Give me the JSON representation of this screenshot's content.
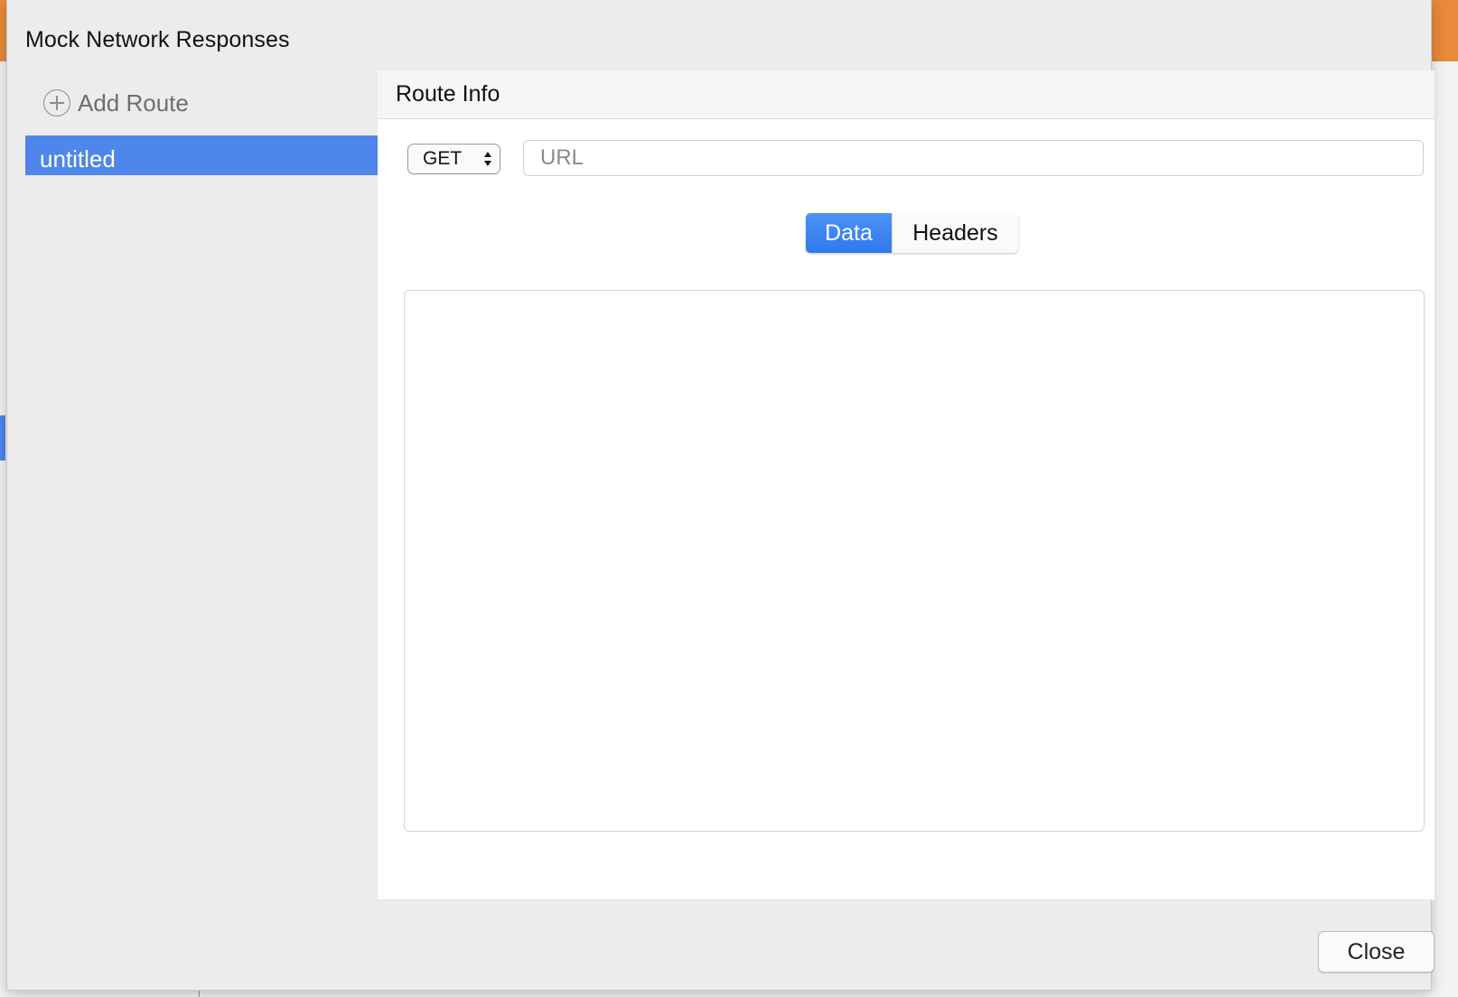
{
  "dialog": {
    "title": "Mock Network Responses",
    "close_label": "Close"
  },
  "sidebar": {
    "add_route_label": "Add Route",
    "add_route_icon": "plus-circle-icon",
    "routes": [
      {
        "label": "untitled",
        "selected": true
      }
    ]
  },
  "route_info": {
    "header": "Route Info",
    "method": "GET",
    "url_value": "",
    "url_placeholder": "URL",
    "tabs": [
      {
        "label": "Data",
        "active": true
      },
      {
        "label": "Headers",
        "active": false
      }
    ],
    "data_value": ""
  },
  "colors": {
    "selection": "#4f86ec",
    "active_tab": "#2f79ee",
    "dialog_bg": "#ececec"
  }
}
